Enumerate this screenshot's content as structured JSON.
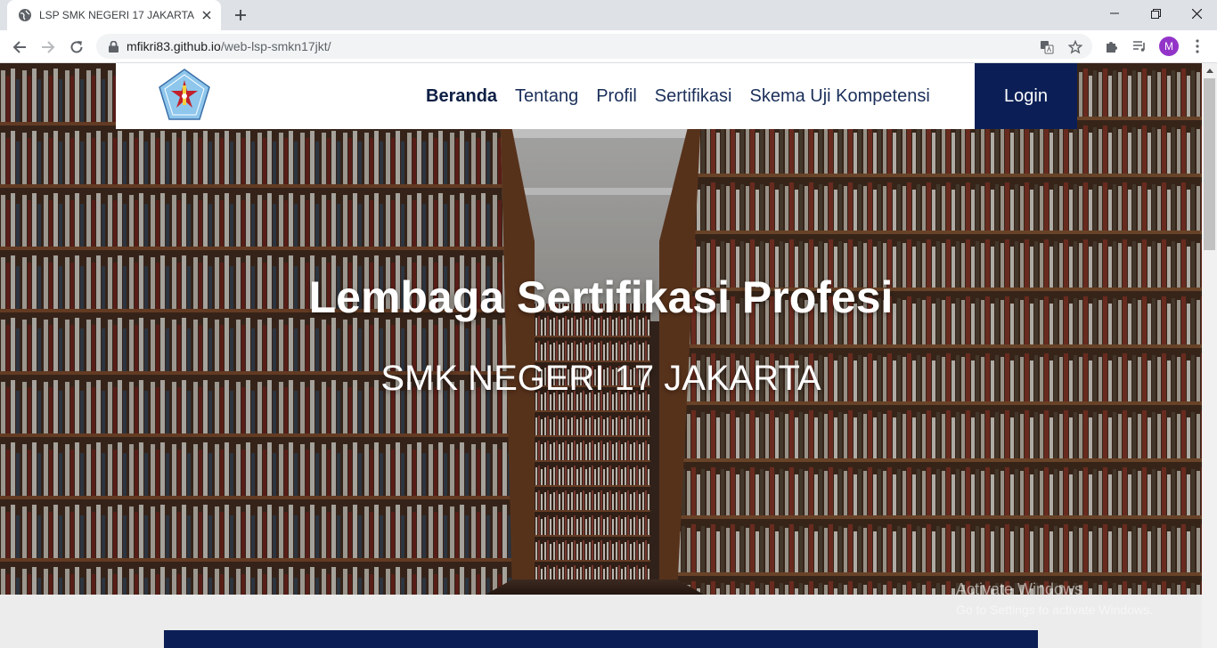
{
  "browser": {
    "tab_title": "LSP SMK NEGERI 17 JAKARTA",
    "url_host": "mfikri83.github.io",
    "url_path": "/web-lsp-smkn17jkt/",
    "profile_initial": "M"
  },
  "nav": {
    "items": [
      {
        "label": "Beranda",
        "active": true
      },
      {
        "label": "Tentang"
      },
      {
        "label": "Profil"
      },
      {
        "label": "Sertifikasi"
      },
      {
        "label": "Skema Uji Kompetensi"
      }
    ],
    "login_label": "Login"
  },
  "hero": {
    "title": "Lembaga Sertifikasi Profesi",
    "subtitle": "SMK NEGERI 17 JAKARTA"
  },
  "watermark": {
    "line1": "Activate Windows",
    "line2": "Go to Settings to activate Windows."
  },
  "colors": {
    "brand_navy": "#0b1f56",
    "nav_text": "#1b2f5a"
  }
}
